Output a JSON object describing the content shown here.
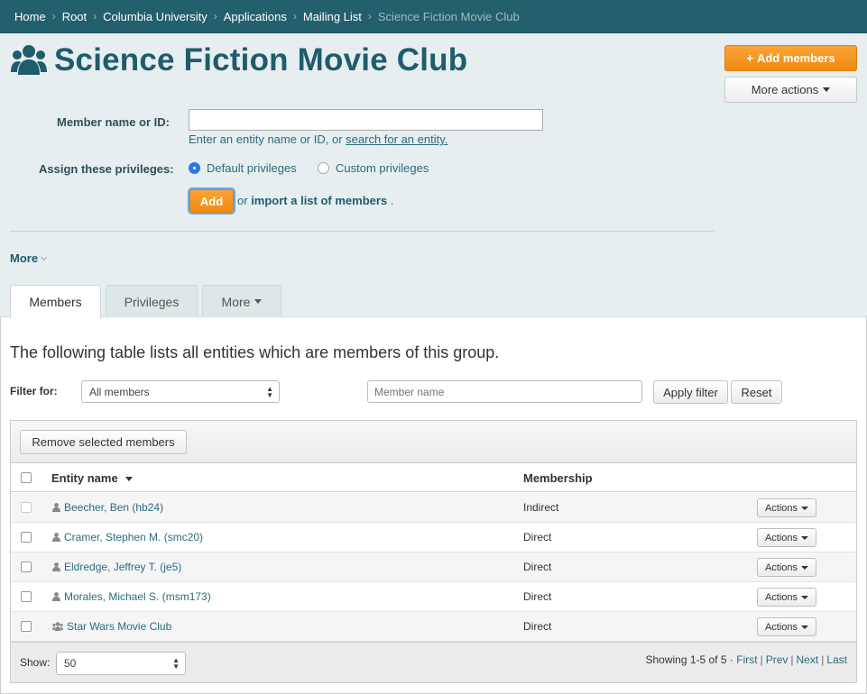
{
  "breadcrumb": [
    "Home",
    "Root",
    "Columbia University",
    "Applications",
    "Mailing List"
  ],
  "breadcrumb_current": "Science Fiction Movie Club",
  "group": {
    "title": "Science Fiction Movie Club"
  },
  "header_buttons": {
    "add_members": "Add members",
    "more_actions": "More actions"
  },
  "form": {
    "member_label": "Member name or ID:",
    "member_value": "",
    "hint_text": "Enter an entity name or ID, or",
    "hint_link": "search for an entity.",
    "privileges_label": "Assign these privileges:",
    "default_privileges": "Default privileges",
    "custom_privileges": "Custom privileges",
    "add_button": "Add",
    "or_text": "or",
    "import_link": "import a list of members",
    "import_period": "."
  },
  "more_toggle": "More",
  "tabs": [
    "Members",
    "Privileges",
    "More"
  ],
  "intro": "The following table lists all entities which are members of this group.",
  "filter": {
    "label": "Filter for:",
    "selected": "All members",
    "placeholder": "Member name",
    "apply": "Apply filter",
    "reset": "Reset"
  },
  "table": {
    "remove_button": "Remove selected members",
    "col_entity": "Entity name",
    "col_membership": "Membership",
    "actions_label": "Actions",
    "rows": [
      {
        "name": "Beecher, Ben (hb24)",
        "membership": "Indirect",
        "type": "person"
      },
      {
        "name": "Cramer, Stephen M. (smc20)",
        "membership": "Direct",
        "type": "person"
      },
      {
        "name": "Eldredge, Jeffrey T. (je5)",
        "membership": "Direct",
        "type": "person"
      },
      {
        "name": "Morales, Michael S. (msm173)",
        "membership": "Direct",
        "type": "person"
      },
      {
        "name": "Star Wars Movie Club",
        "membership": "Direct",
        "type": "group"
      }
    ]
  },
  "footer": {
    "show_label": "Show:",
    "show_value": "50",
    "showing": "Showing 1-5 of 5 ·",
    "first": "First",
    "prev": "Prev",
    "next": "Next",
    "last": "Last"
  },
  "colors": {
    "brand": "#23606e",
    "accent": "#f08b0e",
    "link": "#2a6b7d"
  }
}
